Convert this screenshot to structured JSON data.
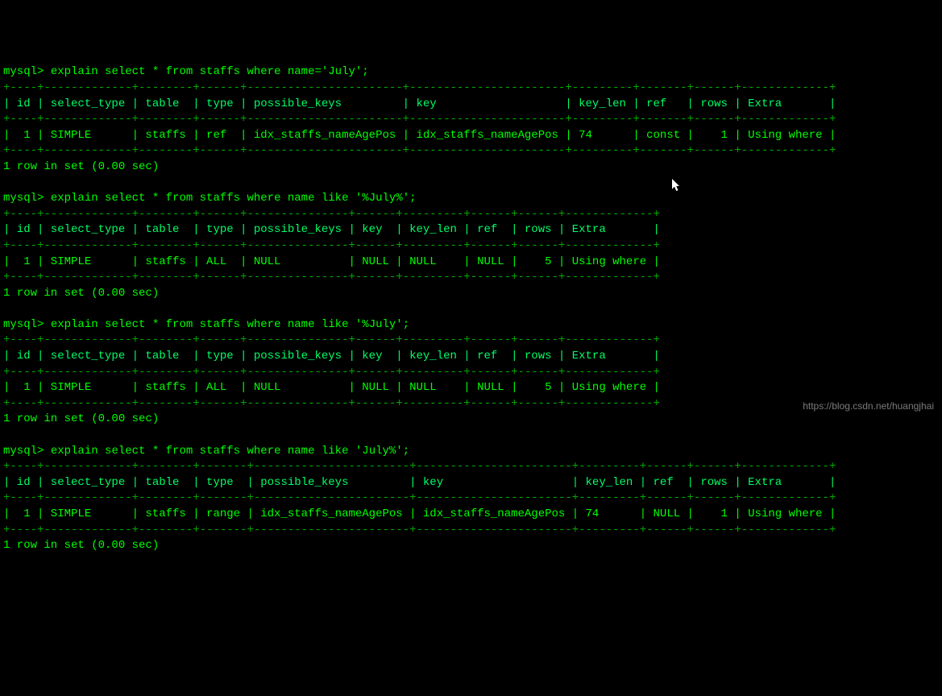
{
  "prompt_label": "mysql>",
  "queries": [
    {
      "sql": "explain select * from staffs where name='July';",
      "sep": "+----+-------------+--------+------+-----------------------+-----------------------+---------+-------+------+-------------+",
      "hdr": "| id | select_type | table  | type | possible_keys         | key                   | key_len | ref   | rows | Extra       |",
      "row": "|  1 | SIMPLE      | staffs | ref  | idx_staffs_nameAgePos | idx_staffs_nameAgePos | 74      | const |    1 | Using where |",
      "footer": "1 row in set (0.00 sec)"
    },
    {
      "sql": "explain select * from staffs where name like '%July%';",
      "sep": "+----+-------------+--------+------+---------------+------+---------+------+------+-------------+",
      "hdr": "| id | select_type | table  | type | possible_keys | key  | key_len | ref  | rows | Extra       |",
      "row": "|  1 | SIMPLE      | staffs | ALL  | NULL          | NULL | NULL    | NULL |    5 | Using where |",
      "footer": "1 row in set (0.00 sec)"
    },
    {
      "sql": "explain select * from staffs where name like '%July';",
      "sep": "+----+-------------+--------+------+---------------+------+---------+------+------+-------------+",
      "hdr": "| id | select_type | table  | type | possible_keys | key  | key_len | ref  | rows | Extra       |",
      "row": "|  1 | SIMPLE      | staffs | ALL  | NULL          | NULL | NULL    | NULL |    5 | Using where |",
      "footer": "1 row in set (0.00 sec)"
    },
    {
      "sql": "explain select * from staffs where name like 'July%';",
      "sep": "+----+-------------+--------+-------+-----------------------+-----------------------+---------+------+------+-------------+",
      "hdr": "| id | select_type | table  | type  | possible_keys         | key                   | key_len | ref  | rows | Extra       |",
      "row": "|  1 | SIMPLE      | staffs | range | idx_staffs_nameAgePos | idx_staffs_nameAgePos | 74      | NULL |    1 | Using where |",
      "footer": "1 row in set (0.00 sec)"
    }
  ],
  "watermark": "https://blog.csdn.net/huangjhai",
  "chart_data": [
    {
      "type": "table",
      "title": "explain select * from staffs where name='July'",
      "columns": [
        "id",
        "select_type",
        "table",
        "type",
        "possible_keys",
        "key",
        "key_len",
        "ref",
        "rows",
        "Extra"
      ],
      "rows": [
        [
          1,
          "SIMPLE",
          "staffs",
          "ref",
          "idx_staffs_nameAgePos",
          "idx_staffs_nameAgePos",
          74,
          "const",
          1,
          "Using where"
        ]
      ]
    },
    {
      "type": "table",
      "title": "explain select * from staffs where name like '%July%'",
      "columns": [
        "id",
        "select_type",
        "table",
        "type",
        "possible_keys",
        "key",
        "key_len",
        "ref",
        "rows",
        "Extra"
      ],
      "rows": [
        [
          1,
          "SIMPLE",
          "staffs",
          "ALL",
          "NULL",
          "NULL",
          "NULL",
          "NULL",
          5,
          "Using where"
        ]
      ]
    },
    {
      "type": "table",
      "title": "explain select * from staffs where name like '%July'",
      "columns": [
        "id",
        "select_type",
        "table",
        "type",
        "possible_keys",
        "key",
        "key_len",
        "ref",
        "rows",
        "Extra"
      ],
      "rows": [
        [
          1,
          "SIMPLE",
          "staffs",
          "ALL",
          "NULL",
          "NULL",
          "NULL",
          "NULL",
          5,
          "Using where"
        ]
      ]
    },
    {
      "type": "table",
      "title": "explain select * from staffs where name like 'July%'",
      "columns": [
        "id",
        "select_type",
        "table",
        "type",
        "possible_keys",
        "key",
        "key_len",
        "ref",
        "rows",
        "Extra"
      ],
      "rows": [
        [
          1,
          "SIMPLE",
          "staffs",
          "range",
          "idx_staffs_nameAgePos",
          "idx_staffs_nameAgePos",
          74,
          "NULL",
          1,
          "Using where"
        ]
      ]
    }
  ]
}
